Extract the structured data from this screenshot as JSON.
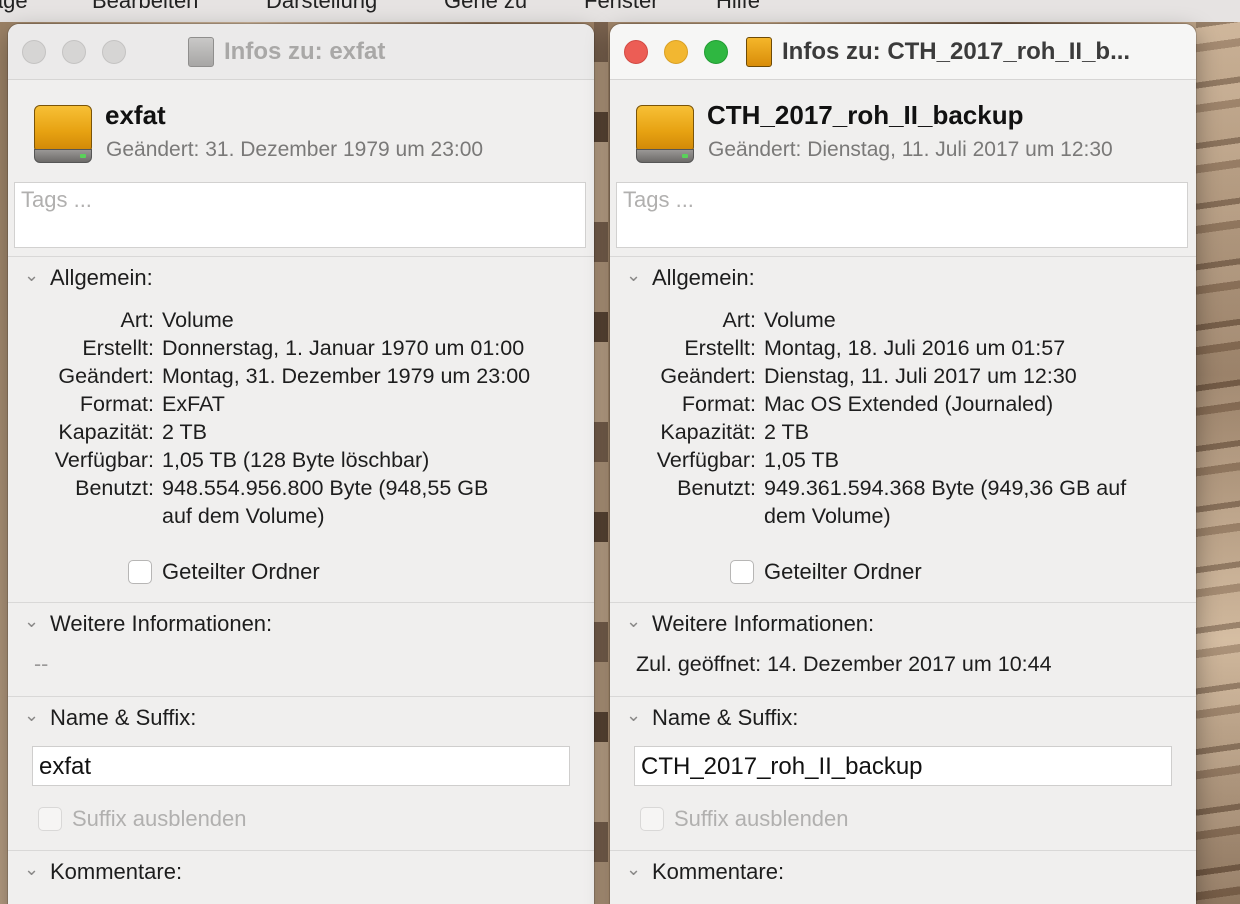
{
  "menubar": {
    "items": [
      "lage",
      "Bearbeiten",
      "Darstellung",
      "Gehe zu",
      "Fenster",
      "Hilfe"
    ]
  },
  "left_window": {
    "title": "Infos zu: exfat",
    "name": "exfat",
    "changed_header": "Geändert: 31. Dezember 1979 um 23:00",
    "tags_placeholder": "Tags ...",
    "general_label": "Allgemein:",
    "general": [
      {
        "k": "Art:",
        "v": "Volume"
      },
      {
        "k": "Erstellt:",
        "v": "Donnerstag, 1. Januar 1970 um 01:00"
      },
      {
        "k": "Geändert:",
        "v": "Montag, 31. Dezember 1979 um 23:00"
      },
      {
        "k": "Format:",
        "v": "ExFAT"
      },
      {
        "k": "Kapazität:",
        "v": "2 TB"
      },
      {
        "k": "Verfügbar:",
        "v": "1,05 TB (128 Byte löschbar)"
      },
      {
        "k": "Benutzt:",
        "v": "948.554.956.800 Byte (948,55 GB"
      },
      {
        "k": "",
        "v": "auf dem Volume)"
      }
    ],
    "shared_folder_label": "Geteilter Ordner",
    "more_info_label": "Weitere Informationen:",
    "more_info_text": "--",
    "name_suffix_label": "Name & Suffix:",
    "name_field_value": "exfat",
    "hide_suffix_label": "Suffix ausblenden",
    "comments_label": "Kommentare:"
  },
  "right_window": {
    "title": "Infos zu: CTH_2017_roh_II_b...",
    "name": "CTH_2017_roh_II_backup",
    "changed_header": "Geändert: Dienstag, 11. Juli 2017 um 12:30",
    "tags_placeholder": "Tags ...",
    "general_label": "Allgemein:",
    "general": [
      {
        "k": "Art:",
        "v": "Volume"
      },
      {
        "k": "Erstellt:",
        "v": "Montag, 18. Juli 2016 um 01:57"
      },
      {
        "k": "Geändert:",
        "v": "Dienstag, 11. Juli 2017 um 12:30"
      },
      {
        "k": "Format:",
        "v": "Mac OS Extended (Journaled)"
      },
      {
        "k": "Kapazität:",
        "v": "2 TB"
      },
      {
        "k": "Verfügbar:",
        "v": "1,05 TB"
      },
      {
        "k": "Benutzt:",
        "v": "949.361.594.368 Byte (949,36 GB auf"
      },
      {
        "k": "",
        "v": "dem Volume)"
      }
    ],
    "shared_folder_label": "Geteilter Ordner",
    "more_info_label": "Weitere Informationen:",
    "more_info_text": "Zul. geöffnet: 14. Dezember 2017 um 10:44",
    "name_suffix_label": "Name & Suffix:",
    "name_field_value": "CTH_2017_roh_II_backup",
    "hide_suffix_label": "Suffix ausblenden",
    "comments_label": "Kommentare:"
  }
}
